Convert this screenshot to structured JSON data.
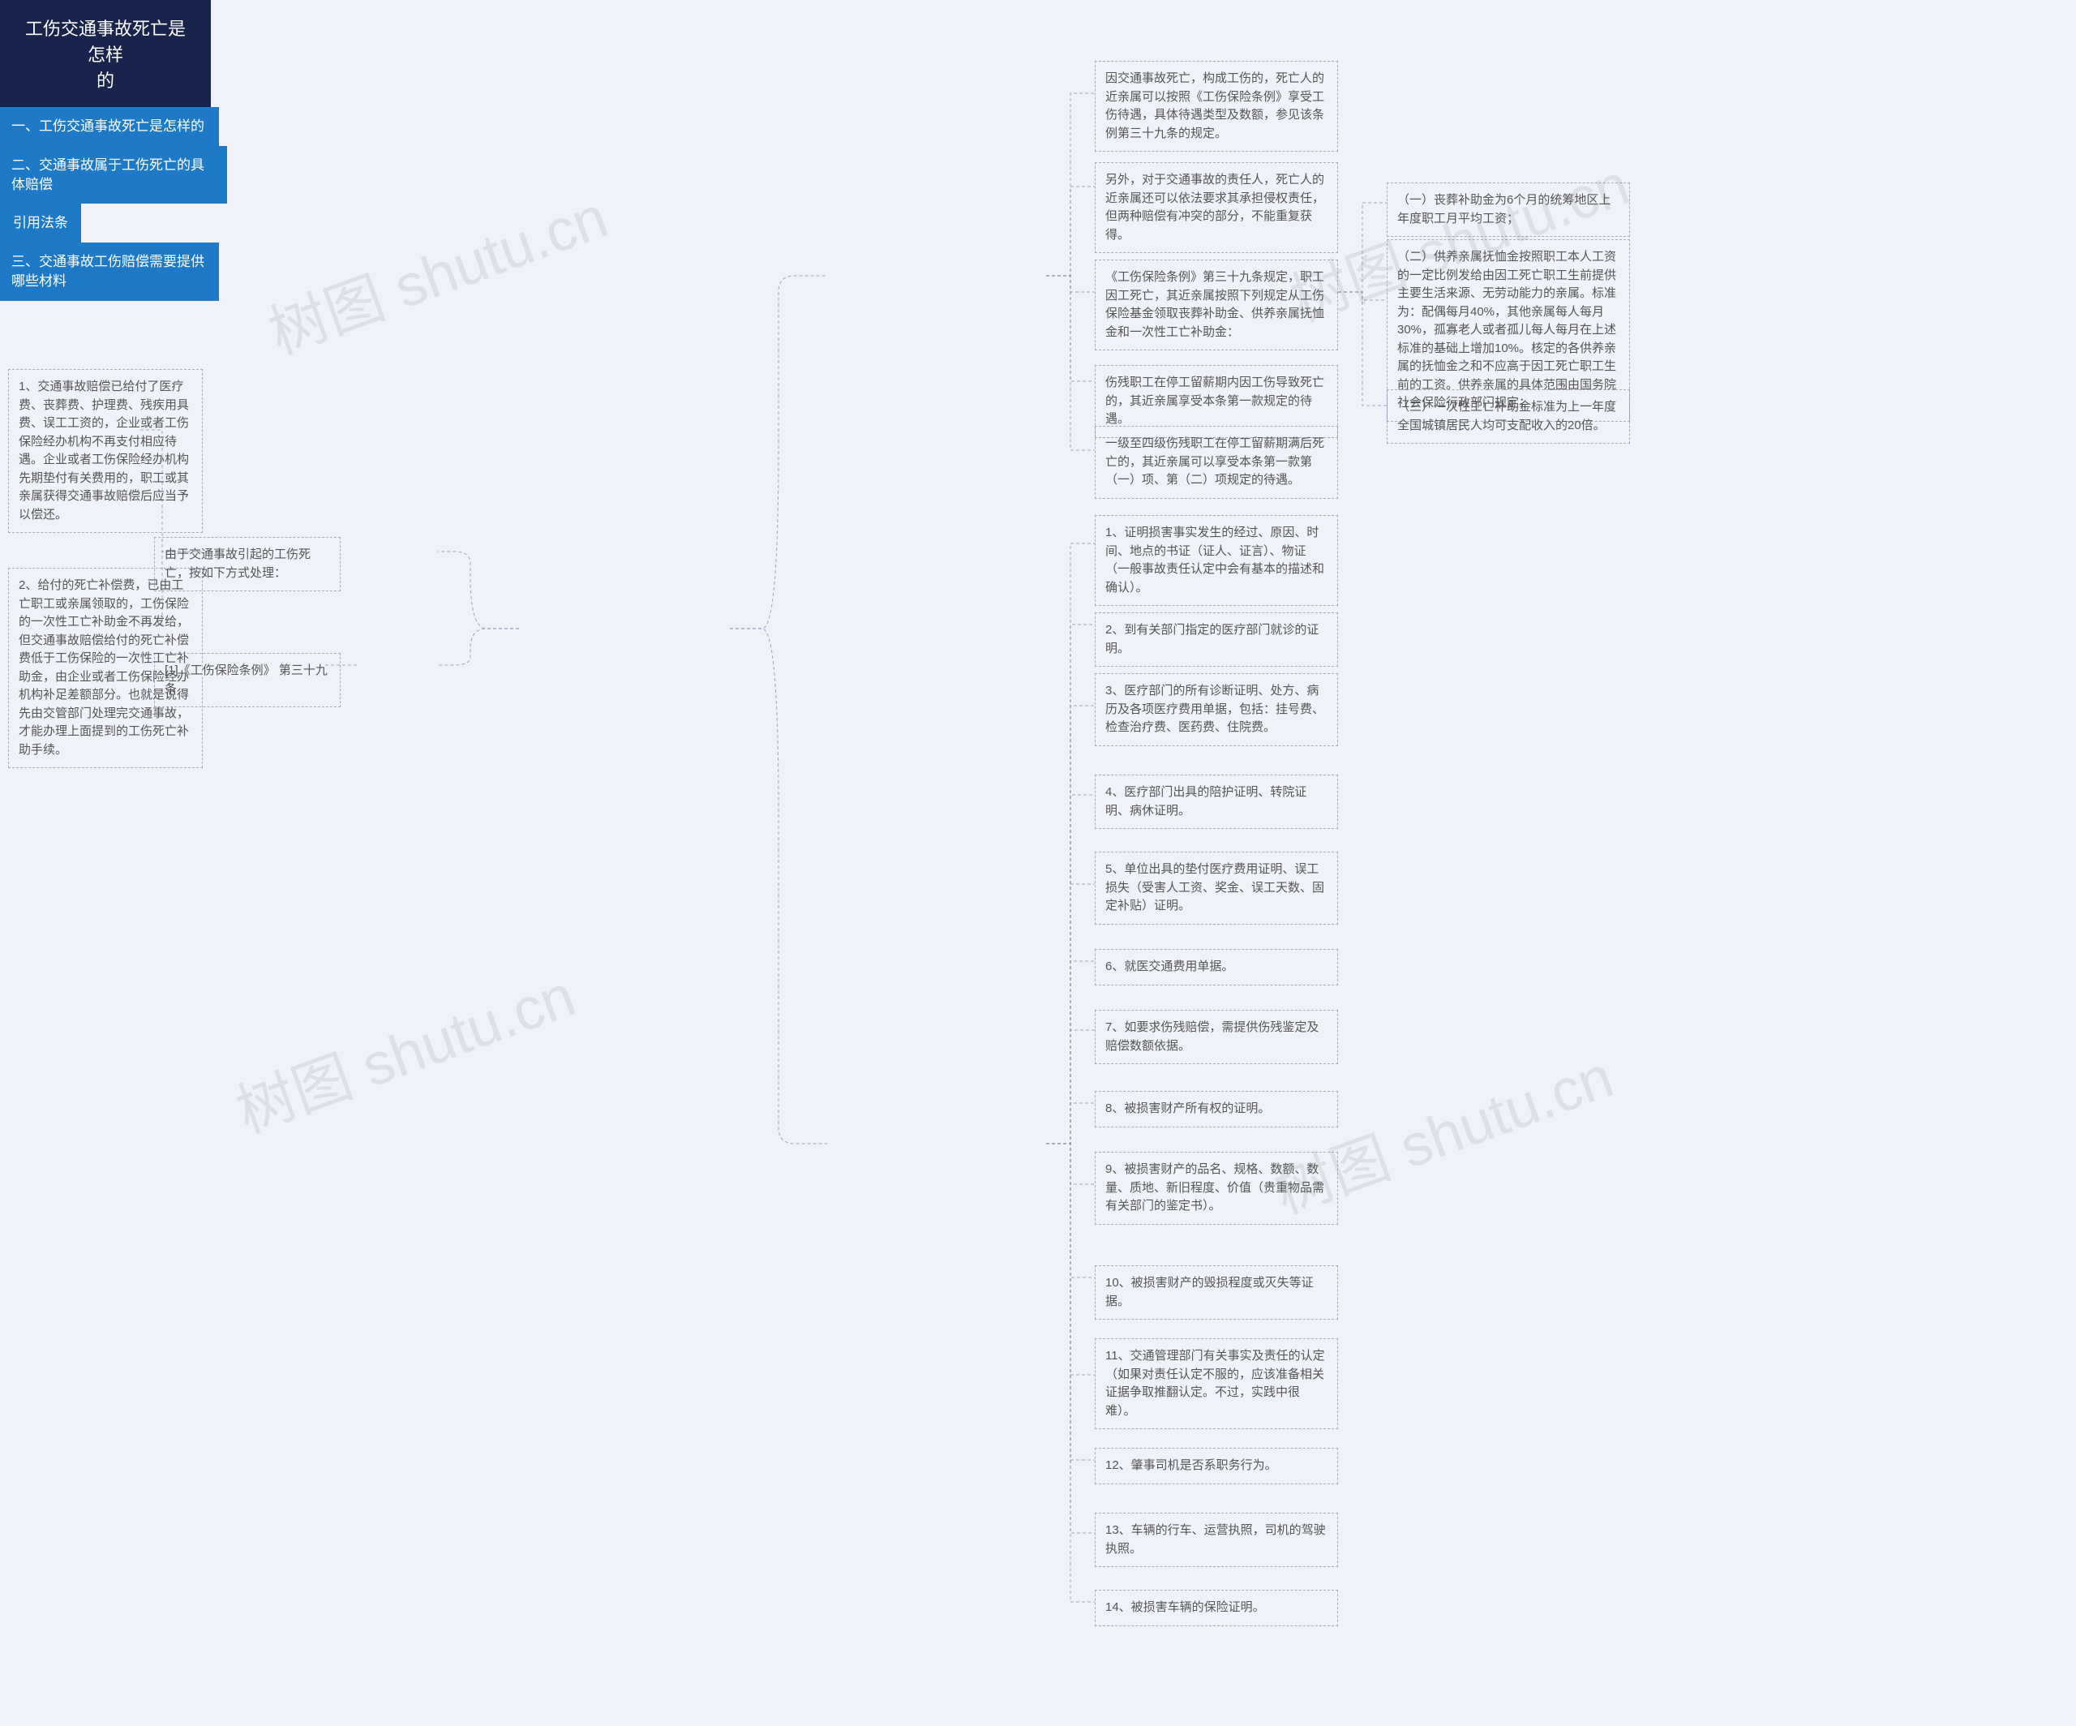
{
  "watermark": "树图 shutu.cn",
  "root": {
    "title_l1": "工伤交通事故死亡是怎样",
    "title_l2": "的"
  },
  "b1": {
    "title": "一、工伤交通事故死亡是怎样的",
    "n1": "因交通事故死亡，构成工伤的，死亡人的近亲属可以按照《工伤保险条例》享受工伤待遇，具体待遇类型及数额，参见该条例第三十九条的规定。",
    "n2": "另外，对于交通事故的责任人，死亡人的近亲属还可以依法要求其承担侵权责任，但两种赔偿有冲突的部分，不能重复获得。",
    "n3": "《工伤保险条例》第三十九条规定，职工因工死亡，其近亲属按照下列规定从工伤保险基金领取丧葬补助金、供养亲属抚恤金和一次性工亡补助金：",
    "n3a": "（一）丧葬补助金为6个月的统筹地区上年度职工月平均工资；",
    "n3b": "（二）供养亲属抚恤金按照职工本人工资的一定比例发给由因工死亡职工生前提供主要生活来源、无劳动能力的亲属。标准为：配偶每月40%，其他亲属每人每月30%，孤寡老人或者孤儿每人每月在上述标准的基础上增加10%。核定的各供养亲属的抚恤金之和不应高于因工死亡职工生前的工资。供养亲属的具体范围由国务院社会保险行政部门规定；",
    "n3c": "（三）一次性工亡补助金标准为上一年度全国城镇居民人均可支配收入的20倍。",
    "n4": "伤残职工在停工留薪期内因工伤导致死亡的，其近亲属享受本条第一款规定的待遇。",
    "n5": "一级至四级伤残职工在停工留薪期满后死亡的，其近亲属可以享受本条第一款第（一）项、第（二）项规定的待遇。"
  },
  "b2": {
    "title": "二、交通事故属于工伤死亡的具体赔偿",
    "mid": "由于交通事故引起的工伤死亡，按如下方式处理：",
    "n1": "1、交通事故赔偿已给付了医疗费、丧葬费、护理费、残疾用具费、误工工资的，企业或者工伤保险经办机构不再支付相应待遇。企业或者工伤保险经办机构先期垫付有关费用的，职工或其亲属获得交通事故赔偿后应当予以偿还。",
    "n2": "2、给付的死亡补偿费，已由工亡职工或亲属领取的，工伤保险的一次性工亡补助金不再发给，但交通事故赔偿给付的死亡补偿费低于工伤保险的一次性工亡补助金，由企业或者工伤保险经办机构补足差额部分。也就是说得先由交管部门处理完交通事故，才能办理上面提到的工伤死亡补助手续。"
  },
  "b3": {
    "title": "三、交通事故工伤赔偿需要提供哪些材料",
    "n1": "1、证明损害事实发生的经过、原因、时间、地点的书证（证人、证言）、物证 （一般事故责任认定中会有基本的描述和确认）。",
    "n2": "2、到有关部门指定的医疗部门就诊的证明。",
    "n3": "3、医疗部门的所有诊断证明、处方、病历及各项医疗费用单据，包括：挂号费、检查治疗费、医药费、住院费。",
    "n4": "4、医疗部门出具的陪护证明、转院证明、病休证明。",
    "n5": "5、单位出具的垫付医疗费用证明、误工损失（受害人工资、奖金、误工天数、固定补贴）证明。",
    "n6": "6、就医交通费用单据。",
    "n7": "7、如要求伤残赔偿，需提供伤残鉴定及赔偿数额依据。",
    "n8": "8、被损害财产所有权的证明。",
    "n9": "9、被损害财产的品名、规格、数额、数量、质地、新旧程度、价值（贵重物品需有关部门的鉴定书）。",
    "n10": "10、被损害财产的毁损程度或灭失等证据。",
    "n11": "11、交通管理部门有关事实及责任的认定 （如果对责任认定不服的，应该准备相关证据争取推翻认定。不过，实践中很难）。",
    "n12": "12、肇事司机是否系职务行为。",
    "n13": "13、车辆的行车、运营执照，司机的驾驶执照。",
    "n14": "14、被损害车辆的保险证明。"
  },
  "b4": {
    "title": "引用法条",
    "n1": "[1]《工伤保险条例》 第三十九条"
  }
}
